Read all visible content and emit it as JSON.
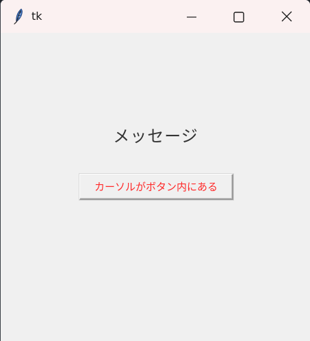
{
  "window": {
    "title": "tk",
    "icons": {
      "app": "feather-icon",
      "minimize": "minimize-icon",
      "maximize": "maximize-icon",
      "close": "close-icon"
    }
  },
  "content": {
    "message": "メッセージ",
    "button_label": "カーソルがボタン内にある"
  },
  "colors": {
    "titlebar_bg": "#fbf1f1",
    "client_bg": "#f0f0f0",
    "button_text": "#ff2a2a",
    "message_text": "#333333"
  }
}
